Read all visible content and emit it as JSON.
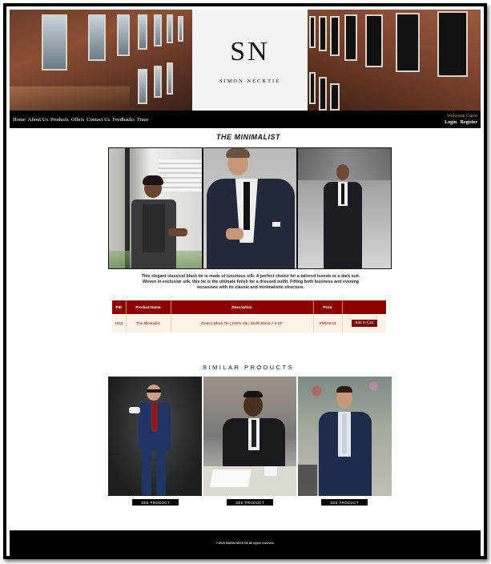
{
  "brand": {
    "monogram": "SN",
    "name": "SIMON NECKTIE"
  },
  "nav": {
    "links": [
      "Home",
      "About Us",
      "Products",
      "Offers",
      "Contact Us",
      "Feedbacks",
      "Trace"
    ],
    "welcome": "Welcome Guest",
    "login": "Login",
    "register": "Register"
  },
  "product": {
    "title": "THE MINIMALIST",
    "description": "This elegant classical black tie is made of luxurious silk. A perfect choice for a tailored tuxedo or a dark suit. Woven in exclusive silk, this tie is the ultimate finish for a dressed outfit. Fitting both business and evening occasions with its classic and minimalistic structure.",
    "table": {
      "headers": [
        "PID",
        "Product Name",
        "Description",
        "Price",
        ""
      ],
      "row": [
        "1010",
        "The Minimalist",
        "Classic Black Tie | 100% silk | Width 80mm / 3.15\"",
        "RM159.53",
        "Add to Cart"
      ]
    }
  },
  "similar": {
    "title": "SIMILAR PRODUCTS",
    "button": "SEE PRODUCT"
  },
  "footer": {
    "text": "© 2023 SIMON NECKTIE All rights reserved."
  }
}
